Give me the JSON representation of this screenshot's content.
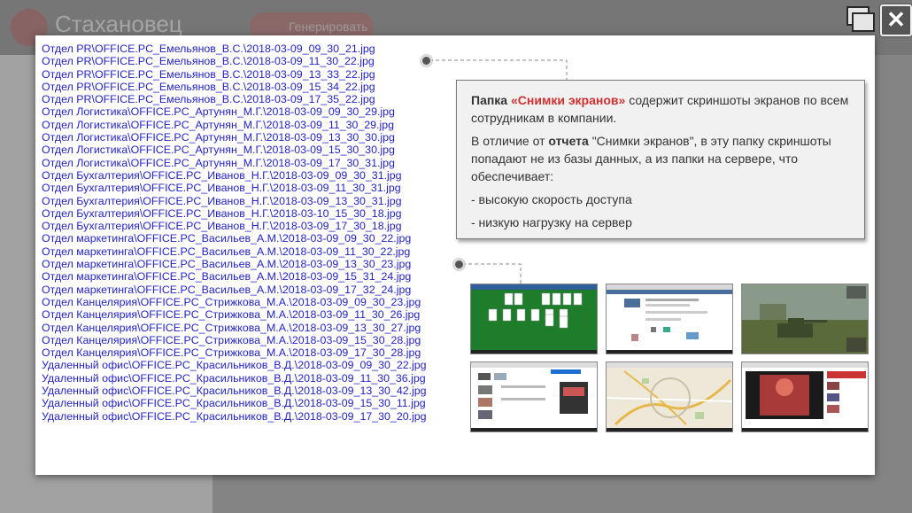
{
  "app": {
    "title": "Стахановец",
    "generate_label": "Генерировать"
  },
  "files": [
    "Отдел PR\\OFFICE.PC_Емельянов_В.С.\\2018-03-09_09_30_21.jpg",
    "Отдел PR\\OFFICE.PC_Емельянов_В.С.\\2018-03-09_11_30_22.jpg",
    "Отдел PR\\OFFICE.PC_Емельянов_В.С.\\2018-03-09_13_33_22.jpg",
    "Отдел PR\\OFFICE.PC_Емельянов_В.С.\\2018-03-09_15_34_22.jpg",
    "Отдел PR\\OFFICE.PC_Емельянов_В.С.\\2018-03-09_17_35_22.jpg",
    "Отдел Логистика\\OFFICE.PC_Артунян_М.Г.\\2018-03-09_09_30_29.jpg",
    "Отдел Логистика\\OFFICE.PC_Артунян_М.Г.\\2018-03-09_11_30_29.jpg",
    "Отдел Логистика\\OFFICE.PC_Артунян_М.Г.\\2018-03-09_13_30_30.jpg",
    "Отдел Логистика\\OFFICE.PC_Артунян_М.Г.\\2018-03-09_15_30_30.jpg",
    "Отдел Логистика\\OFFICE.PC_Артунян_М.Г.\\2018-03-09_17_30_31.jpg",
    "Отдел Бухгалтерия\\OFFICE.PC_Иванов_Н.Г.\\2018-03-09_09_30_31.jpg",
    "Отдел Бухгалтерия\\OFFICE.PC_Иванов_Н.Г.\\2018-03-09_11_30_31.jpg",
    "Отдел Бухгалтерия\\OFFICE.PC_Иванов_Н.Г.\\2018-03-09_13_30_31.jpg",
    "Отдел Бухгалтерия\\OFFICE.PC_Иванов_Н.Г.\\2018-03-10_15_30_18.jpg",
    "Отдел Бухгалтерия\\OFFICE.PC_Иванов_Н.Г.\\2018-03-09_17_30_18.jpg",
    "Отдел маркетинга\\OFFICE.PC_Васильев_А.М.\\2018-03-09_09_30_22.jpg",
    "Отдел маркетинга\\OFFICE.PC_Васильев_А.М.\\2018-03-09_11_30_22.jpg",
    "Отдел маркетинга\\OFFICE.PC_Васильев_А.М.\\2018-03-09_13_30_23.jpg",
    "Отдел маркетинга\\OFFICE.PC_Васильев_А.М.\\2018-03-09_15_31_24.jpg",
    "Отдел маркетинга\\OFFICE.PC_Васильев_А.М.\\2018-03-09_17_32_24.jpg",
    "Отдел Канцелярия\\OFFICE.PC_Стрижкова_М.А.\\2018-03-09_09_30_23.jpg",
    "Отдел Канцелярия\\OFFICE.PC_Стрижкова_М.А.\\2018-03-09_11_30_26.jpg",
    "Отдел Канцелярия\\OFFICE.PC_Стрижкова_М.А.\\2018-03-09_13_30_27.jpg",
    "Отдел Канцелярия\\OFFICE.PC_Стрижкова_М.А.\\2018-03-09_15_30_28.jpg",
    "Отдел Канцелярия\\OFFICE.PC_Стрижкова_М.А.\\2018-03-09_17_30_28.jpg",
    "Удаленный офис\\OFFICE.PC_Красильников_В.Д.\\2018-03-09_09_30_22.jpg",
    "Удаленный офис\\OFFICE.PC_Красильников_В.Д.\\2018-03-09_11_30_36.jpg",
    "Удаленный офис\\OFFICE.PC_Красильников_В.Д.\\2018-03-09_13_30_42.jpg",
    "Удаленный офис\\OFFICE.PC_Красильников_В.Д.\\2018-03-09_15_30_11.jpg",
    "Удаленный офис\\OFFICE.PC_Красильников_В.Д.\\2018-03-09_17_30_20.jpg"
  ],
  "callout": {
    "folder_word": "Папка",
    "folder_name": "«Снимки экранов»",
    "line1_rest": "содержит скриншоты экранов по всем сотрудникам в компании.",
    "line2_a": "В отличие от",
    "line2_bold": "отчета",
    "line2_rest": "\"Снимки экранов\", в эту папку скриншоты попадают не из базы данных, а из папки на сервере, что обеспечивает:",
    "bullet1": "- высокую скорость доступа",
    "bullet2": "- низкую нагрузку на сервер"
  },
  "thumbnails": [
    {
      "name": "thumb-solitaire",
      "caption": ""
    },
    {
      "name": "thumb-social",
      "caption": ""
    },
    {
      "name": "thumb-game",
      "caption": ""
    },
    {
      "name": "thumb-shop",
      "caption": ""
    },
    {
      "name": "thumb-map",
      "caption": ""
    },
    {
      "name": "thumb-video",
      "caption": ""
    }
  ],
  "colors": {
    "link": "#2323c8",
    "accent_red": "#d03030",
    "callout_bg": "#f1f1f1"
  }
}
